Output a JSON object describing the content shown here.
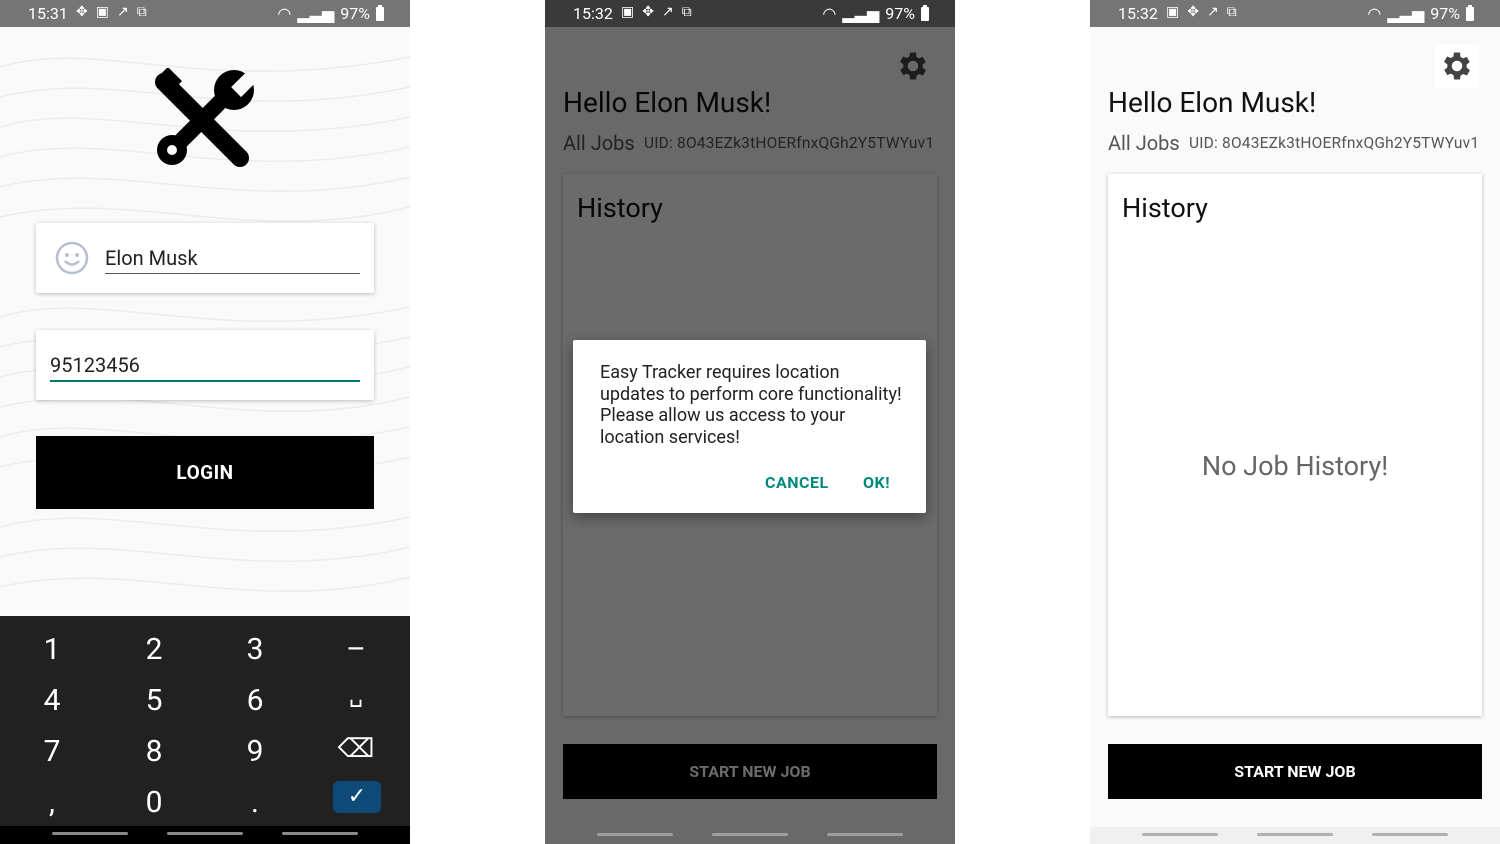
{
  "status_bars": [
    {
      "time": "15:31",
      "battery": "97%"
    },
    {
      "time": "15:32",
      "battery": "97%"
    },
    {
      "time": "15:32",
      "battery": "97%"
    }
  ],
  "login": {
    "name_value": "Elon Musk",
    "phone_value": "95123456",
    "login_label": "LOGIN",
    "keys": [
      "1",
      "2",
      "3",
      "–",
      "4",
      "5",
      "6",
      "␣",
      "7",
      "8",
      "9",
      "⌫",
      ",",
      "0",
      ".",
      "✓"
    ],
    "accent": "#00796b"
  },
  "dashboard": {
    "greeting": "Hello Elon Musk!",
    "all_jobs_label": "All Jobs",
    "uid": "UID: 8O43EZk3tHOERfnxQGh2Y5TWYuv1",
    "history_title": "History",
    "empty_text": "No Job History!",
    "start_label": "START NEW JOB"
  },
  "dialog": {
    "message": "Easy Tracker requires location updates to perform core functionality! Please allow us access to your location services!",
    "cancel_label": "CANCEL",
    "ok_label": "OK!",
    "button_color": "#00897b"
  }
}
